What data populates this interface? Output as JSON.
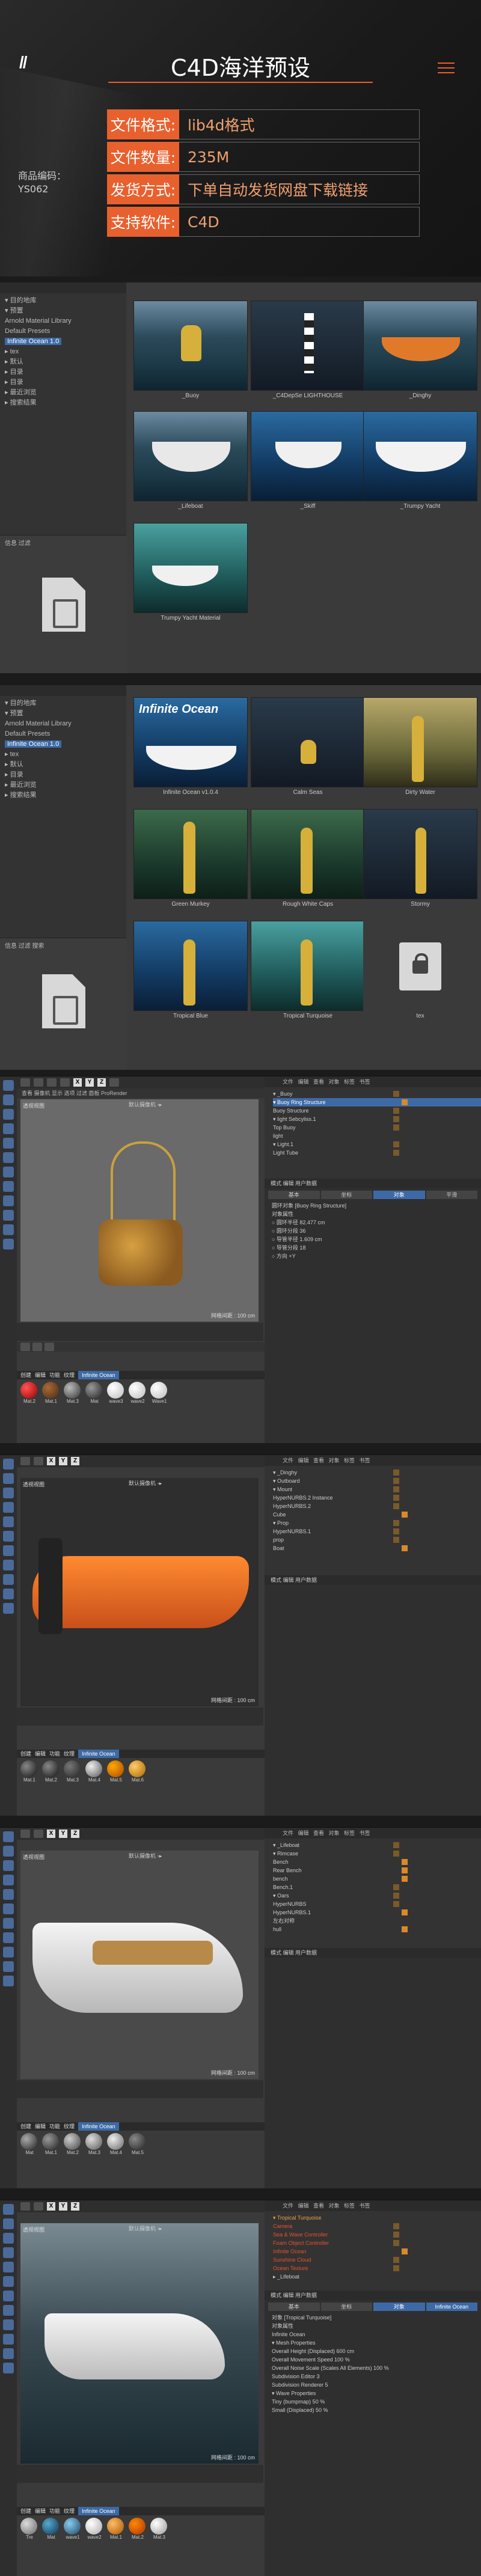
{
  "header": {
    "logo": "//",
    "title": "C4D海洋预设",
    "specs": [
      {
        "key": "文件格式:",
        "value": "lib4d格式"
      },
      {
        "key": "文件数量:",
        "value": "235M"
      },
      {
        "key": "发货方式:",
        "value": "下单自动发货网盘下载链接"
      },
      {
        "key": "支持软件:",
        "value": "C4D"
      }
    ],
    "code_label": "商品编码：",
    "code_value": "YS062"
  },
  "browser1": {
    "tree": [
      "▾ 目的地库",
      "  ▾ 预置",
      "    Arnold Material Library",
      "    Default Presets",
      "    Infinite Ocean 1.0",
      "      ▸ tex",
      "      ▸ 默认",
      "  ▸ 目录",
      "  ▸ 目录",
      "  ▸ 最近浏览",
      "  ▸ 搜索结果"
    ],
    "selected_index": 4,
    "bottom_tabs": "信息  过滤",
    "items": [
      "_Buoy",
      "_C4DepSe LIGHTHOUSE",
      "_Dinghy",
      "_Lifeboat",
      "_Skiff",
      "_Trumpy Yacht",
      "Trumpy Yacht Material"
    ]
  },
  "browser2": {
    "tree": [
      "▾ 目的地库",
      "  ▾ 预置",
      "    Arnold Material Library",
      "    Default Presets",
      "    Infinite Ocean 1.0",
      "      ▸ tex",
      "      ▸ 默认",
      "  ▸ 目录",
      "  ▸ 最近浏览",
      "  ▸ 搜索结果"
    ],
    "selected_index": 4,
    "bottom_tabs": "信息  过滤  搜索",
    "banner": "Infinite Ocean",
    "items": [
      "Infinite Ocean v1.0.4",
      "Calm Seas",
      "Dirty Water",
      "Green Murkey",
      "Rough White Caps",
      "Stormy",
      "Tropical Blue",
      "Tropical Turquoise",
      "tex"
    ]
  },
  "c4d1": {
    "menu": "查看  摄像机  显示  选项  过滤  面板  ProRender",
    "view_label": "透视视图",
    "grid_label": "默认摄像机 ◦▸",
    "distance": "网格间距 : 100 cm",
    "frames": [
      "0",
      "10",
      "20",
      "30",
      "40",
      "50",
      "60",
      "70",
      "80",
      "90"
    ],
    "mat_tabs": [
      "创建",
      "编辑",
      "功能",
      "纹理",
      "Infinite Ocean"
    ],
    "materials": [
      "Mat.2",
      "Mat.1",
      "Mat.3",
      "Mat",
      "wave3",
      "wave2",
      "Wave1"
    ],
    "objects": [
      "▾ _Buoy",
      "  ▾ Buoy Ring Structure",
      "    Buoy Structure",
      "  ▾ light Sebcyliss.1",
      "    Top Buoy",
      "    light",
      "  ▾ Light.1",
      "    Light Tube"
    ],
    "attr_title": "模式  编辑  用户数据",
    "attr_tabs": [
      "基本",
      "坐标",
      "对象",
      "平滑"
    ],
    "attr_lines": [
      "圆环对象 [Buoy Ring Structure]",
      "对象属性",
      "○ 圆环半径  82.477 cm",
      "○ 圆环分段  36",
      "○ 导管半径  1.609 cm",
      "○ 导管分段  18",
      "○ 方向  +Y"
    ]
  },
  "c4d2": {
    "view_label": "透视视图",
    "grid_label": "默认摄像机 ◦▸",
    "distance": "网格间距 : 100 cm",
    "mat_tabs": [
      "创建",
      "编辑",
      "功能",
      "纹理",
      "Infinite Ocean"
    ],
    "materials": [
      "Mat.1",
      "Mat.2",
      "Mat.3",
      "Mat.4",
      "Mat.5",
      "Mat.6"
    ],
    "objects": [
      "▾ _Dinghy",
      "  ▾ Outboard",
      "    ▾ Mount",
      "      HyperNURBS.2 Instance",
      "      HyperNURBS.2",
      "        Cube",
      "    ▾ Prop",
      "      HyperNURBS.1",
      "        prop",
      "        Boat"
    ],
    "attr_title": "模式  编辑  用户数据"
  },
  "c4d3": {
    "view_label": "透视视图",
    "grid_label": "默认摄像机 ◦▸",
    "distance": "网格间距 : 100 cm",
    "mat_tabs": [
      "创建",
      "编辑",
      "功能",
      "纹理",
      "Infinite Ocean"
    ],
    "materials": [
      "Mat",
      "Mat.1",
      "Mat.2",
      "Mat.3",
      "Mat.4",
      "Mat.5"
    ],
    "objects": [
      "▾ _Lifeboat",
      "  ▾ Rimcase",
      "    Bench",
      "    Rear Bench",
      "    bench",
      "    Bench.1",
      "  ▾ Oars",
      "    HyperNURBS",
      "    HyperNURBS.1",
      "    左右对称",
      "    hull"
    ],
    "attr_title": "模式  编辑  用户数据"
  },
  "c4d4": {
    "view_label": "透视视图",
    "grid_label": "默认摄像机 ◦▸",
    "distance": "网格间距 : 100 cm",
    "mat_tabs": [
      "创建",
      "编辑",
      "功能",
      "纹理",
      "Infinite Ocean"
    ],
    "materials": [
      "Tre",
      "Mat",
      "wave1",
      "wave2",
      "Mat.1",
      "Mat.2",
      "Mat.3"
    ],
    "objects": [
      "▾ Tropical Turquoise",
      "    Camera",
      "    Sea & Wave Controller",
      "    Foam Object Controller",
      "    Infinite Ocean",
      "    Sunshine Cloud",
      "    Ocean Texture",
      "  ▸ _Lifeboat"
    ],
    "attr_title": "模式  编辑  用户数据",
    "attr_tabs": [
      "基本",
      "坐标",
      "对象",
      "Infinite Ocean"
    ],
    "attr_lines": [
      "对象 [Tropical Turquoise]",
      "对象属性",
      "Infinite Ocean",
      "▾ Mesh Properties",
      "  Overall Height (Displaced)  600 cm",
      "  Overall Movement Speed  100 %",
      "  Overall Noise Scale (Scales All Elements)  100 %",
      "  Subdivision Editor  3",
      "  Subdivision Renderer  5",
      "▾ Wave Properties",
      "  Tiny (bumpmap)  50 %",
      "  Small (Displaced)  50 %"
    ]
  }
}
